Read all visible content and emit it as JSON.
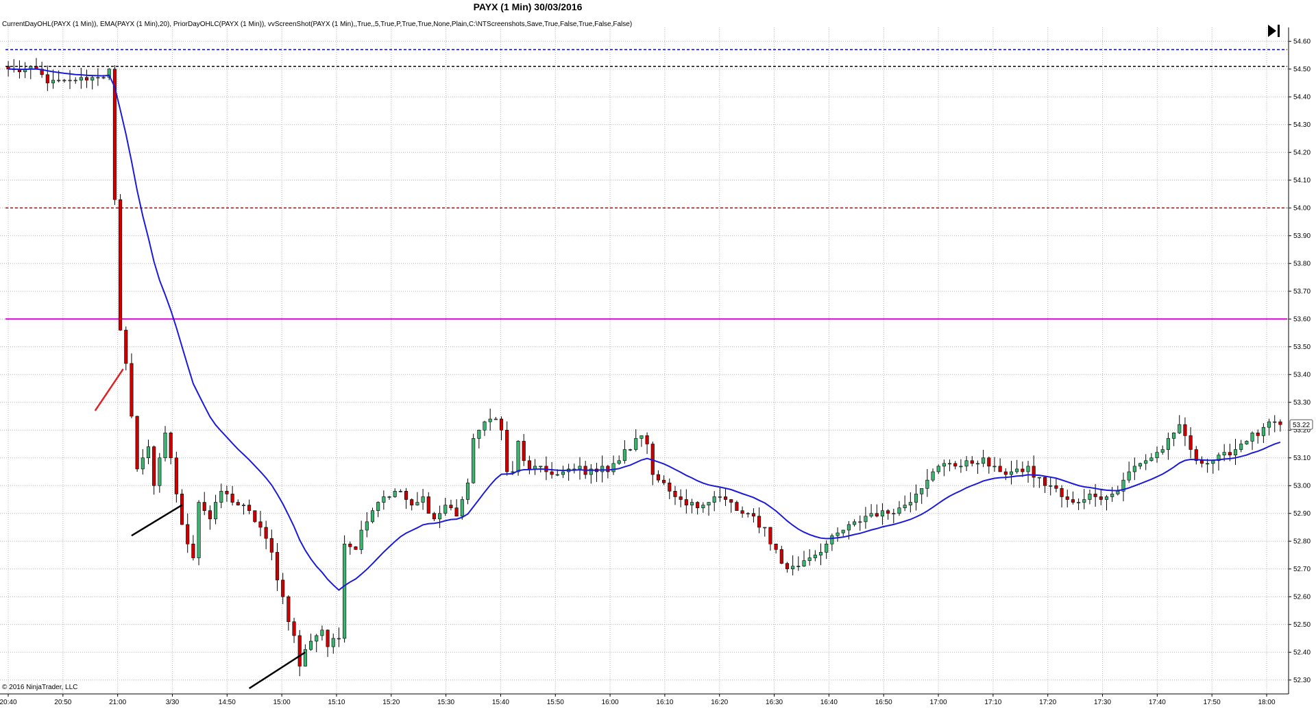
{
  "title": "PAYX (1 Min)  30/03/2016",
  "indicators": "CurrentDayOHL(PAYX (1 Min)), EMA(PAYX (1 Min),20), PriorDayOHLC(PAYX (1 Min)), vvScreenShot(PAYX (1 Min),,True,,5,True,P,True,True,None,Plain,C:\\NTScreenshots,Save,True,False,True,False,False)",
  "copyright": "© 2016 NinjaTrader, LLC",
  "price_badge": "53.22",
  "colors": {
    "up_candle": "#3cb371",
    "down_candle": "#cc0000",
    "ema": "#1a1adb",
    "grid": "#b4b4b4",
    "prior_high": "#0000cc",
    "current_open": "#000000",
    "prior_close": "#cc0000",
    "prior_low": "#e000e0"
  },
  "chart_data": {
    "type": "candlestick",
    "symbol": "PAYX",
    "interval": "1 Min",
    "ylim": [
      52.25,
      54.65
    ],
    "y_ticks": [
      "54.60",
      "54.50",
      "54.40",
      "54.30",
      "54.20",
      "54.10",
      "54.00",
      "53.90",
      "53.80",
      "53.70",
      "53.60",
      "53.50",
      "53.40",
      "53.30",
      "53.20",
      "53.10",
      "53.00",
      "52.90",
      "52.80",
      "52.70",
      "52.60",
      "52.50",
      "52.40",
      "52.30"
    ],
    "x_ticks": [
      "20:40",
      "20:50",
      "21:00",
      "3/30",
      "14:50",
      "15:00",
      "15:10",
      "15:20",
      "15:30",
      "15:40",
      "15:50",
      "16:00",
      "16:10",
      "16:20",
      "16:30",
      "16:40",
      "16:50",
      "17:00",
      "17:10",
      "17:20",
      "17:30",
      "17:40",
      "17:50",
      "18:00"
    ],
    "horizontal_lines": [
      {
        "value": 54.57,
        "style": "dashed",
        "color_key": "prior_high"
      },
      {
        "value": 54.51,
        "style": "dashed",
        "color_key": "current_open"
      },
      {
        "value": 54.0,
        "style": "dashed",
        "color_key": "prior_close"
      },
      {
        "value": 53.6,
        "style": "solid",
        "color_key": "prior_low"
      }
    ],
    "ema_period": 20,
    "close_path": [
      [
        0,
        54.5
      ],
      [
        5,
        54.49
      ],
      [
        8,
        54.45
      ],
      [
        12,
        54.46
      ],
      [
        17,
        54.48
      ],
      [
        18,
        54.49
      ],
      [
        20,
        53.55
      ],
      [
        21,
        53.45
      ],
      [
        23,
        53.05
      ],
      [
        25,
        53.15
      ],
      [
        26,
        53.0
      ],
      [
        28,
        53.18
      ],
      [
        29,
        53.1
      ],
      [
        31,
        52.85
      ],
      [
        33,
        52.75
      ],
      [
        34,
        52.95
      ],
      [
        36,
        52.88
      ],
      [
        38,
        52.98
      ],
      [
        40,
        52.95
      ],
      [
        43,
        52.9
      ],
      [
        45,
        52.85
      ],
      [
        47,
        52.75
      ],
      [
        49,
        52.6
      ],
      [
        51,
        52.45
      ],
      [
        52,
        52.35
      ],
      [
        54,
        52.45
      ],
      [
        56,
        52.48
      ],
      [
        57,
        52.42
      ],
      [
        59,
        52.45
      ],
      [
        60,
        52.8
      ],
      [
        62,
        52.78
      ],
      [
        64,
        52.88
      ],
      [
        66,
        52.95
      ],
      [
        68,
        52.97
      ],
      [
        70,
        52.98
      ],
      [
        72,
        52.92
      ],
      [
        74,
        52.95
      ],
      [
        76,
        52.88
      ],
      [
        78,
        52.93
      ],
      [
        80,
        52.9
      ],
      [
        82,
        53.0
      ],
      [
        83,
        53.18
      ],
      [
        85,
        53.22
      ],
      [
        87,
        53.25
      ],
      [
        88,
        53.2
      ],
      [
        89,
        53.05
      ],
      [
        90,
        53.05
      ],
      [
        91,
        53.15
      ],
      [
        92,
        53.08
      ],
      [
        94,
        53.06
      ],
      [
        96,
        53.05
      ],
      [
        98,
        53.04
      ],
      [
        100,
        53.05
      ],
      [
        102,
        53.06
      ],
      [
        104,
        53.05
      ],
      [
        106,
        53.08
      ],
      [
        107,
        53.05
      ],
      [
        109,
        53.1
      ],
      [
        111,
        53.14
      ],
      [
        113,
        53.18
      ],
      [
        114,
        53.15
      ],
      [
        115,
        53.05
      ],
      [
        117,
        53.0
      ],
      [
        119,
        52.95
      ],
      [
        121,
        52.93
      ],
      [
        123,
        52.93
      ],
      [
        125,
        52.95
      ],
      [
        127,
        52.96
      ],
      [
        129,
        52.93
      ],
      [
        131,
        52.9
      ],
      [
        133,
        52.88
      ],
      [
        135,
        52.85
      ],
      [
        136,
        52.8
      ],
      [
        138,
        52.72
      ],
      [
        140,
        52.7
      ],
      [
        142,
        52.73
      ],
      [
        144,
        52.76
      ],
      [
        146,
        52.79
      ],
      [
        148,
        52.82
      ],
      [
        150,
        52.85
      ],
      [
        152,
        52.88
      ],
      [
        154,
        52.9
      ],
      [
        156,
        52.9
      ],
      [
        158,
        52.91
      ],
      [
        160,
        52.93
      ],
      [
        162,
        52.98
      ],
      [
        164,
        53.03
      ],
      [
        166,
        53.06
      ],
      [
        168,
        53.08
      ],
      [
        170,
        53.07
      ],
      [
        172,
        53.09
      ],
      [
        174,
        53.09
      ],
      [
        176,
        53.06
      ],
      [
        178,
        53.05
      ],
      [
        180,
        53.05
      ],
      [
        182,
        53.06
      ],
      [
        184,
        53.02
      ],
      [
        186,
        53.0
      ],
      [
        188,
        52.96
      ],
      [
        190,
        52.93
      ],
      [
        192,
        52.96
      ],
      [
        194,
        52.97
      ],
      [
        196,
        52.96
      ],
      [
        198,
        52.98
      ],
      [
        200,
        53.05
      ],
      [
        202,
        53.08
      ],
      [
        204,
        53.1
      ],
      [
        206,
        53.14
      ],
      [
        208,
        53.18
      ],
      [
        209,
        53.22
      ],
      [
        210,
        53.18
      ],
      [
        211,
        53.12
      ],
      [
        212,
        53.1
      ],
      [
        214,
        53.08
      ],
      [
        216,
        53.1
      ],
      [
        218,
        53.12
      ],
      [
        220,
        53.15
      ],
      [
        222,
        53.18
      ],
      [
        224,
        53.2
      ],
      [
        225,
        53.22
      ],
      [
        227,
        53.21
      ]
    ],
    "annotations": [
      {
        "type": "trendline",
        "color": "#e02020",
        "from": [
          15.5,
          53.27
        ],
        "to": [
          20.5,
          53.42
        ]
      },
      {
        "type": "trendline",
        "color": "#000000",
        "from": [
          22,
          52.82
        ],
        "to": [
          31,
          52.93
        ]
      },
      {
        "type": "trendline",
        "color": "#000000",
        "from": [
          43,
          52.27
        ],
        "to": [
          53,
          52.4
        ]
      }
    ],
    "last_price": 53.22
  }
}
